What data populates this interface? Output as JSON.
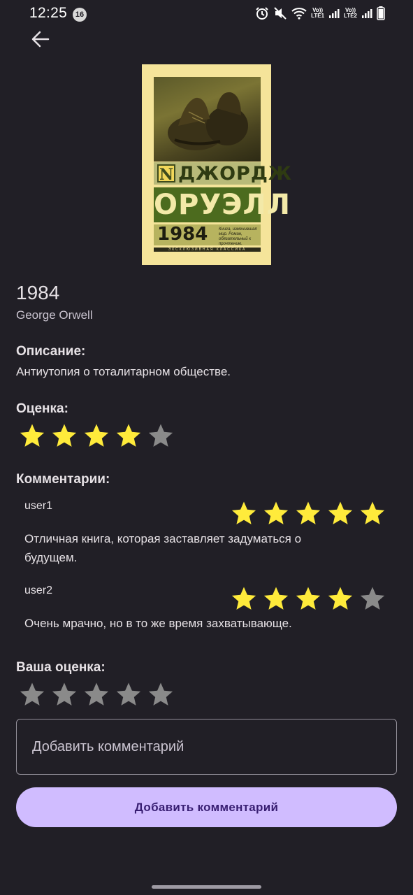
{
  "status_bar": {
    "time": "12:25",
    "notification_count": "16",
    "sim1_volte": "Vo))",
    "sim1_lte": "LTE1",
    "sim2_volte": "Vo))",
    "sim2_lte": "LTE2"
  },
  "cover": {
    "series_initial": "N",
    "author_first": "ДЖОРДЖ",
    "author_last": "ОРУЭЛЛ",
    "title": "1984",
    "blurb": "Книга, изменившая мир. Роман, обязательный к прочтению.",
    "series_name": "ЭКСКЛЮЗИВНАЯ КЛАССИКА"
  },
  "book": {
    "title": "1984",
    "author": "George Orwell"
  },
  "description": {
    "label": "Описание:",
    "text": "Антиутопия о тоталитарном обществе."
  },
  "rating": {
    "label": "Оценка:",
    "value": 4,
    "max": 5
  },
  "comments": {
    "label": "Комментарии:",
    "items": [
      {
        "user": "user1",
        "rating": 5,
        "text": "Отличная книга, которая заставляет задуматься о будущем."
      },
      {
        "user": "user2",
        "rating": 4,
        "text": "Очень мрачно, но в то же время захватывающе."
      }
    ]
  },
  "your_rating": {
    "label": "Ваша оценка:",
    "value": 0,
    "max": 5
  },
  "comment_input": {
    "placeholder": "Добавить комментарий"
  },
  "submit_button": {
    "label": "Добавить комментарий"
  },
  "colors": {
    "background": "#211f26",
    "star_filled": "#ffeb3b",
    "star_empty": "#8a8a8a",
    "button_bg": "#d0bcff",
    "button_text": "#381e72"
  }
}
